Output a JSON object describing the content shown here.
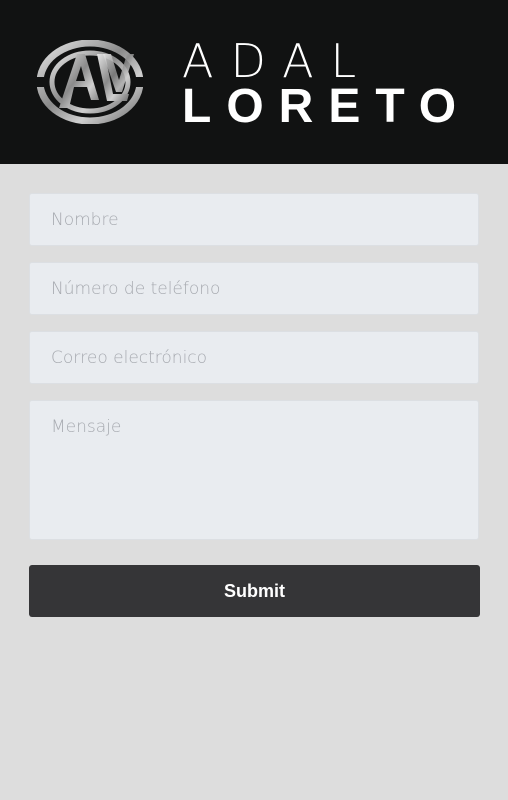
{
  "header": {
    "logo_icon": "al-monogram-logo",
    "brand_line1": "ADAL",
    "brand_line2": "LORETO"
  },
  "form": {
    "name_placeholder": "Nombre",
    "phone_placeholder": "Número de teléfono",
    "email_placeholder": "Correo electrónico",
    "message_placeholder": "Mensaje",
    "submit_label": "Submit"
  },
  "colors": {
    "header_bg": "#111212",
    "page_bg": "#dddddd",
    "field_bg": "#e9ecf0",
    "button_bg": "#353537"
  }
}
